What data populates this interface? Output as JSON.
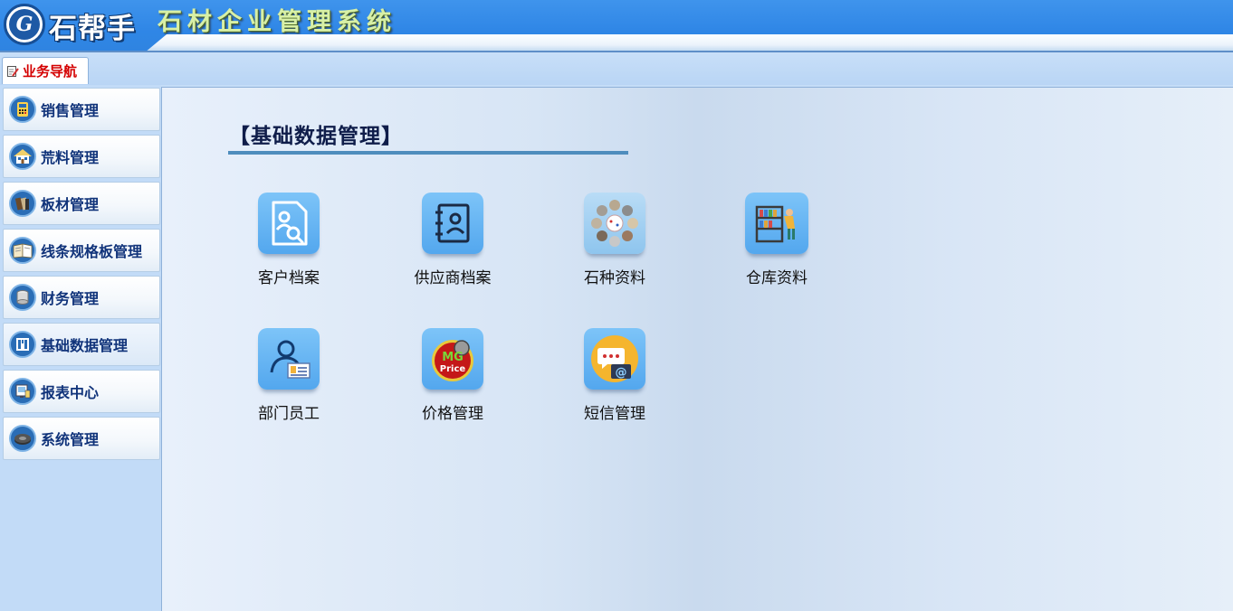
{
  "header": {
    "brand": "石帮手",
    "system_title": "石材企业管理系统"
  },
  "tabs": [
    {
      "label": "业务导航",
      "icon": "notepad-pencil-icon"
    }
  ],
  "sidebar": {
    "items": [
      {
        "label": "销售管理",
        "icon": "calculator-icon"
      },
      {
        "label": "荒料管理",
        "icon": "house-icon"
      },
      {
        "label": "板材管理",
        "icon": "stone-slab-icon"
      },
      {
        "label": "线条规格板管理",
        "icon": "open-book-icon"
      },
      {
        "label": "财务管理",
        "icon": "coin-roll-icon"
      },
      {
        "label": "基础数据管理",
        "icon": "building-icon"
      },
      {
        "label": "报表中心",
        "icon": "report-monitor-icon"
      },
      {
        "label": "系统管理",
        "icon": "gear-icon"
      }
    ],
    "active_index": 5
  },
  "main": {
    "section_title": "【基础数据管理】",
    "tiles": [
      {
        "label": "客户档案",
        "icon": "customer-file-icon"
      },
      {
        "label": "供应商档案",
        "icon": "supplier-contact-book-icon"
      },
      {
        "label": "石种资料",
        "icon": "stone-samples-icon"
      },
      {
        "label": "仓库资料",
        "icon": "warehouse-shelf-icon"
      },
      {
        "label": "部门员工",
        "icon": "employee-badge-icon"
      },
      {
        "label": "价格管理",
        "icon": "price-tag-icon"
      },
      {
        "label": "短信管理",
        "icon": "message-bubble-icon"
      }
    ]
  },
  "colors": {
    "header_blue": "#2f86e6",
    "nav_tab_text": "#d40000",
    "sidebar_text": "#10337a",
    "title_rule": "#4e8dbd"
  }
}
